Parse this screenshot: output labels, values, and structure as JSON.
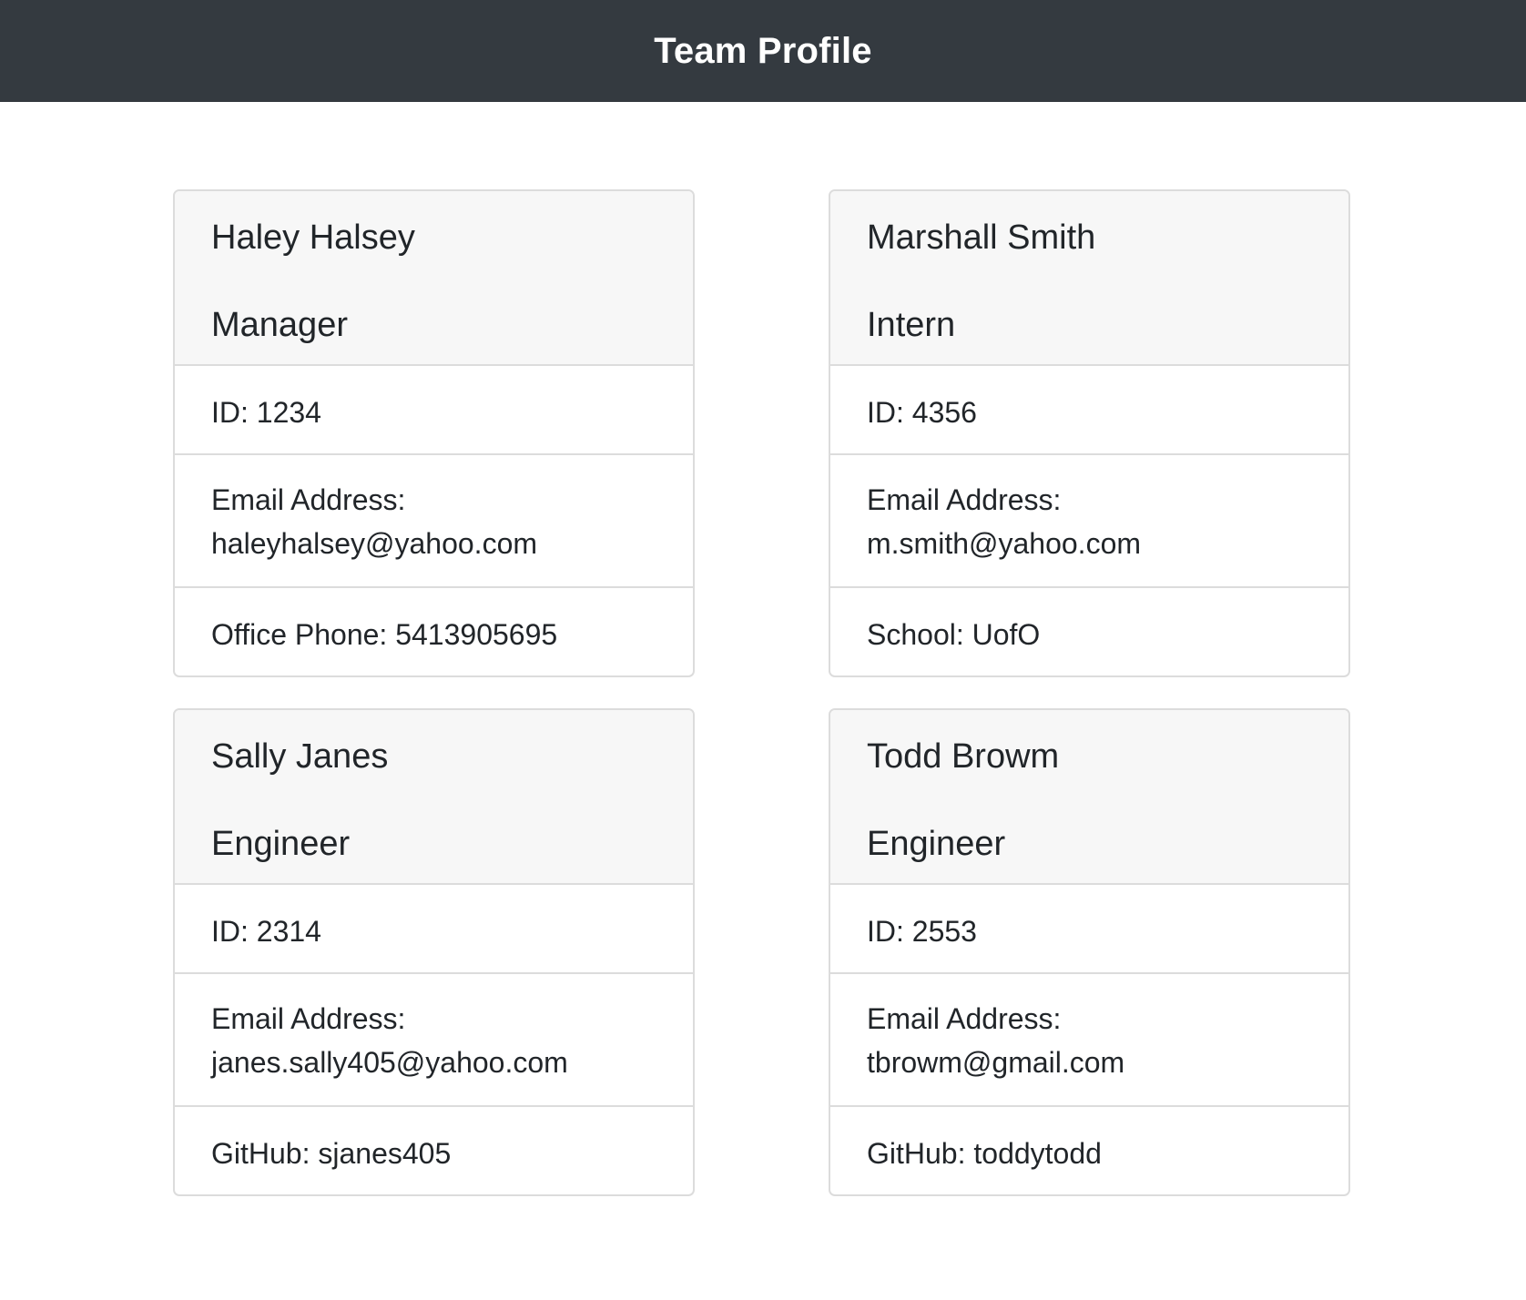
{
  "header": {
    "title": "Team Profile"
  },
  "team": [
    {
      "name": "Haley Halsey",
      "role": "Manager",
      "id": "ID: 1234",
      "email_label": "Email Address:",
      "email": "haleyhalsey@yahoo.com",
      "extra": "Office Phone: 5413905695"
    },
    {
      "name": "Marshall Smith",
      "role": "Intern",
      "id": "ID: 4356",
      "email_label": "Email Address:",
      "email": "m.smith@yahoo.com",
      "extra": "School: UofO"
    },
    {
      "name": "Sally Janes",
      "role": "Engineer",
      "id": "ID: 2314",
      "email_label": "Email Address:",
      "email": "janes.sally405@yahoo.com",
      "extra": "GitHub: sjanes405"
    },
    {
      "name": "Todd Browm",
      "role": "Engineer",
      "id": "ID: 2553",
      "email_label": "Email Address:",
      "email": "tbrowm@gmail.com",
      "extra": "GitHub: toddytodd"
    }
  ],
  "colors": {
    "navbar_bg": "#343a40",
    "card_header_bg": "#f7f7f7",
    "border": "#dcdcdc",
    "text": "#212529"
  }
}
